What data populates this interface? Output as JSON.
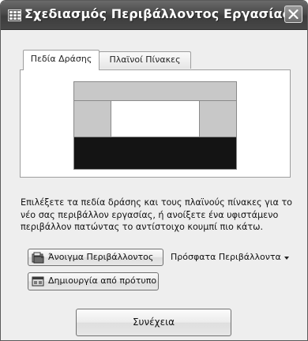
{
  "window": {
    "title": "Σχεδιασμός Περιβάλλοντος Εργασίας"
  },
  "tabs": [
    {
      "label": "Πεδία Δράσης",
      "active": true
    },
    {
      "label": "Πλαϊνοί Πίνακες",
      "active": false
    }
  ],
  "description": "Επιλέξετε τα πεδία δράσης και τους πλαϊνούς πίνακες για το νέο σας περιβάλλον εργασίας, ή ανοίξετε ένα υφιστάμενο περιβάλλον πατώντας το αντίστοιχο κουμπί πιο κάτω.",
  "buttons": {
    "open_environment": "Άνοιγμα Περιβάλλοντος",
    "recent_environments": "Πρόσφατα Περιβάλλοντα",
    "create_from_template": "Δημιουργία από πρότυπο",
    "continue": "Συνέχεια"
  },
  "icons": {
    "app": "grid-icon",
    "close": "close-icon",
    "open": "open-folder-icon",
    "template": "template-icon",
    "dropdown": "chevron-down-icon"
  }
}
